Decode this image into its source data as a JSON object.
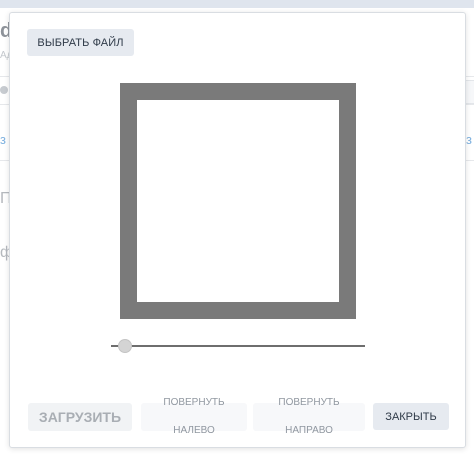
{
  "background_fragments": {
    "letter_d": "d",
    "sub_text": "Ад",
    "blue_link": "з",
    "mid_text": "П",
    "mid_text2": "ф"
  },
  "modal": {
    "choose_file_label": "ВЫБРАТЬ ФАЙЛ",
    "zoom_level": 0.03,
    "upload_label": "ЗАГРУЗИТЬ",
    "rotate_left_line1": "ПОВЕРНУТЬ",
    "rotate_left_line2": "НАЛЕВО",
    "rotate_right_line1": "ПОВЕРНУТЬ",
    "rotate_right_line2": "НАПРАВО",
    "close_label": "ЗАКРЫТЬ"
  },
  "icons": {
    "crop_area": "crop-frame",
    "slider_thumb": "zoom-handle"
  },
  "colors": {
    "crop_frame": "#7a7a7a",
    "button_bg": "#e6eaf0",
    "button_text": "#2f3a48",
    "disabled_text": "#a9aeb4"
  }
}
